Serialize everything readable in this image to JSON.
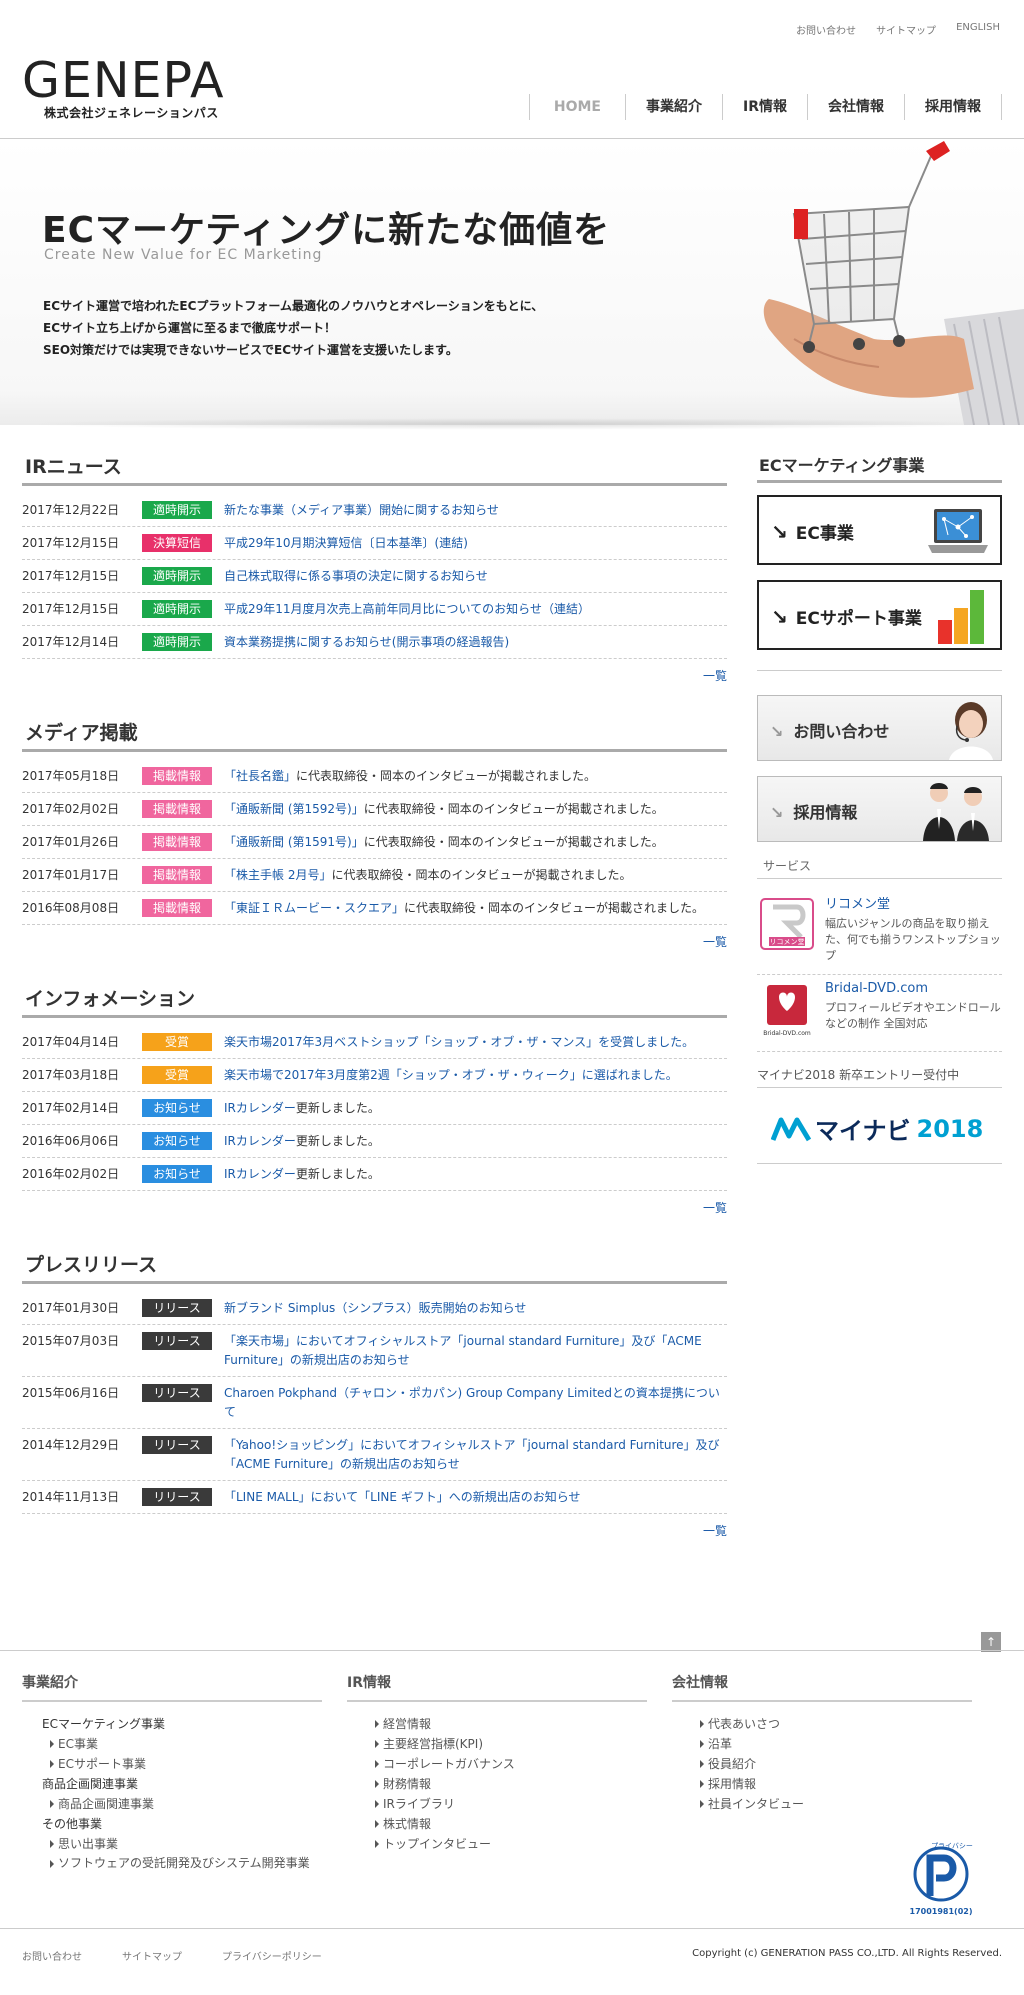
{
  "util_nav": [
    "お問い合わせ",
    "サイトマップ",
    "ENGLISH"
  ],
  "logo": {
    "main": "GENEPA",
    "sub": "株式会社ジェネレーションパス"
  },
  "gnav": [
    "HOME",
    "事業紹介",
    "IR情報",
    "会社情報",
    "採用情報"
  ],
  "hero": {
    "title": "ECマーケティングに新たな価値を",
    "subtitle": "Create New Value for EC Marketing",
    "lines": [
      "ECサイト運営で培われたECプラットフォーム最適化のノウハウとオペレーションをもとに、",
      "ECサイト立ち上げから運営に至るまで徹底サポート！",
      "SEO対策だけでは実現できないサービスでECサイト運営を支援いたします。"
    ]
  },
  "colors": {
    "ir_open": "#1aa84b",
    "ir_tanshin": "#e8306a",
    "media": "#f0669e",
    "award": "#f6a21a",
    "notice": "#2a8ee0",
    "release": "#3a3a3a"
  },
  "ir_news": {
    "title": "IRニュース",
    "more": "一覧",
    "items": [
      {
        "date": "2017年12月22日",
        "badge": "適時開示",
        "text": "新たな事業（メディア事業）開始に関するお知らせ"
      },
      {
        "date": "2017年12月15日",
        "badge": "決算短信",
        "text": "平成29年10月期決算短信〔日本基準〕(連結)"
      },
      {
        "date": "2017年12月15日",
        "badge": "適時開示",
        "text": "自己株式取得に係る事項の決定に関するお知らせ"
      },
      {
        "date": "2017年12月15日",
        "badge": "適時開示",
        "text": "平成29年11月度月次売上高前年同月比についてのお知らせ（連結）"
      },
      {
        "date": "2017年12月14日",
        "badge": "適時開示",
        "text": "資本業務提携に関するお知らせ(開示事項の経過報告)"
      }
    ]
  },
  "media": {
    "title": "メディア掲載",
    "more": "一覧",
    "items": [
      {
        "date": "2017年05月18日",
        "badge": "掲載情報",
        "link": "「社長名鑑」",
        "text": "に代表取締役・岡本のインタビューが掲載されました。"
      },
      {
        "date": "2017年02月02日",
        "badge": "掲載情報",
        "link": "「通販新聞 (第1592号)」",
        "text": "に代表取締役・岡本のインタビューが掲載されました。"
      },
      {
        "date": "2017年01月26日",
        "badge": "掲載情報",
        "link": "「通販新聞 (第1591号)」",
        "text": "に代表取締役・岡本のインタビューが掲載されました。"
      },
      {
        "date": "2017年01月17日",
        "badge": "掲載情報",
        "link": "「株主手帳 2月号」",
        "text": "に代表取締役・岡本のインタビューが掲載されました。"
      },
      {
        "date": "2016年08月08日",
        "badge": "掲載情報",
        "link": "「東証ＩＲムービー・スクエア」",
        "text": "に代表取締役・岡本のインタビューが掲載されました。"
      }
    ]
  },
  "info": {
    "title": "インフォメーション",
    "more": "一覧",
    "items": [
      {
        "date": "2017年04月14日",
        "badge": "受賞",
        "link": "楽天市場2017年3月ベストショップ「ショップ・オブ・ザ・マンス」を受賞しました。",
        "text": ""
      },
      {
        "date": "2017年03月18日",
        "badge": "受賞",
        "link": "楽天市場で2017年3月度第2週「ショップ・オブ・ザ・ウィーク」に選ばれました。",
        "text": ""
      },
      {
        "date": "2017年02月14日",
        "badge": "お知らせ",
        "link": "IRカレンダー",
        "text": "更新しました。"
      },
      {
        "date": "2016年06月06日",
        "badge": "お知らせ",
        "link": "IRカレンダー",
        "text": "更新しました。"
      },
      {
        "date": "2016年02月02日",
        "badge": "お知らせ",
        "link": "IRカレンダー",
        "text": "更新しました。"
      }
    ]
  },
  "press": {
    "title": "プレスリリース",
    "more": "一覧",
    "items": [
      {
        "date": "2017年01月30日",
        "badge": "リリース",
        "text": "新ブランド Simplus（シンプラス）販売開始のお知らせ"
      },
      {
        "date": "2015年07月03日",
        "badge": "リリース",
        "text": "「楽天市場」においてオフィシャルストア「journal standard Furniture」及び「ACME Furniture」の新規出店のお知らせ"
      },
      {
        "date": "2015年06月16日",
        "badge": "リリース",
        "text": "Charoen Pokphand（チャロン・ポカパン) Group Company Limitedとの資本提携について"
      },
      {
        "date": "2014年12月29日",
        "badge": "リリース",
        "text": "「Yahoo!ショッピング」においてオフィシャルストア「journal standard Furniture」及び「ACME Furniture」の新規出店のお知らせ"
      },
      {
        "date": "2014年11月13日",
        "badge": "リリース",
        "text": "「LINE MALL」において「LINE ギフト」への新規出店のお知らせ"
      }
    ]
  },
  "sidebar": {
    "title": "ECマーケティング事業",
    "ec": "EC事業",
    "ec_support": "ECサポート事業",
    "contact": "お問い合わせ",
    "recruit": "採用情報",
    "service_title": "サービス",
    "services": [
      {
        "name": "リコメン堂",
        "desc": "幅広いジャンルの商品を取り揃えた、何でも揃うワンストップショップ",
        "logo_text": "リコメン堂"
      },
      {
        "name": "Bridal-DVD.com",
        "desc": "プロフィールビデオやエンドロールなどの制作 全国対応",
        "logo_text": "Bridal-DVD.com"
      }
    ],
    "mynavi_caption": "マイナビ2018 新卒エントリー受付中",
    "mynavi_name": "マイナビ",
    "mynavi_year": "2018"
  },
  "footer": {
    "col1": {
      "title": "事業紹介",
      "groups": [
        {
          "label": "ECマーケティング事業",
          "items": [
            "EC事業",
            "ECサポート事業"
          ]
        },
        {
          "label": "商品企画関連事業",
          "items": [
            "商品企画関連事業"
          ]
        },
        {
          "label": "その他事業",
          "items": [
            "思い出事業",
            "ソフトウェアの受託開発及びシステム開発事業"
          ]
        }
      ]
    },
    "col2": {
      "title": "IR情報",
      "items": [
        "経営情報",
        "主要経営指標(KPI)",
        "コーポレートガバナンス",
        "財務情報",
        "IRライブラリ",
        "株式情報",
        "トップインタビュー"
      ]
    },
    "col3": {
      "title": "会社情報",
      "items": [
        "代表あいさつ",
        "沿革",
        "役員紹介",
        "採用情報",
        "社員インタビュー"
      ]
    },
    "privacy_mark_text": "プライバシー",
    "privacy_mark_num": "17001981(02)",
    "bottom_links": [
      "お問い合わせ",
      "サイトマップ",
      "プライバシーポリシー"
    ],
    "copyright": "Copyright (c) GENERATION PASS CO.,LTD. All Rights Reserved."
  }
}
